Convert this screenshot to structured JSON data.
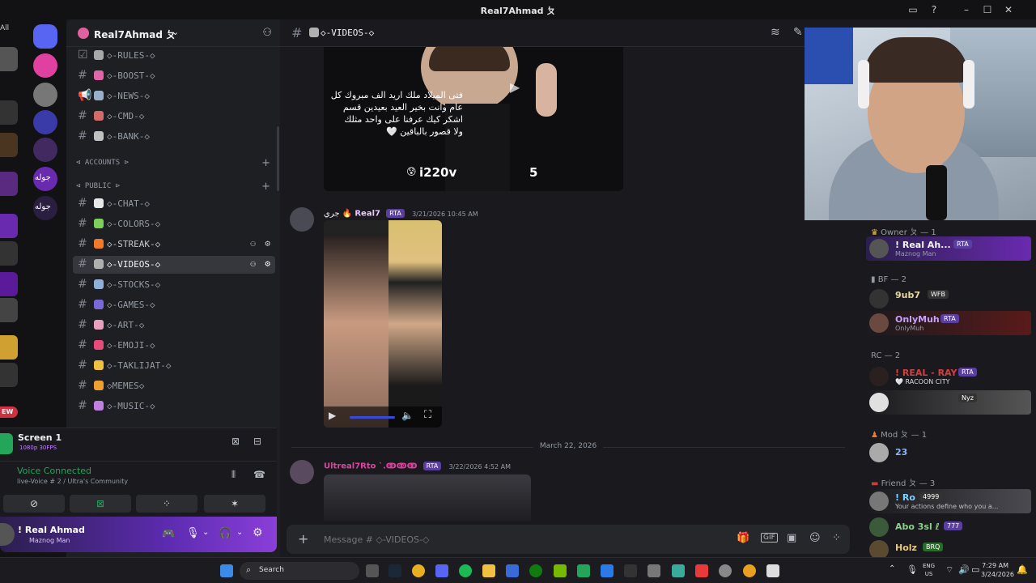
{
  "window": {
    "title": "Real7Ahmad ㄆ",
    "left_fragment": "All"
  },
  "server": {
    "name": "Real7Ahmad ㄆ"
  },
  "channels_top": [
    {
      "name": "◇-RULES-◇",
      "icon": "rules-icon",
      "color": "#a8a8a8"
    },
    {
      "name": "◇-BOOST-◇",
      "icon": "boost-icon",
      "color": "#e066a8"
    },
    {
      "name": "◇-NEWS-◇",
      "icon": "news-icon",
      "color": "#9ab0c8"
    },
    {
      "name": "◇-CMD-◇",
      "icon": "cmd-icon",
      "color": "#d46a6a"
    },
    {
      "name": "◇-BANK-◇",
      "icon": "bank-icon",
      "color": "#c0c0c0"
    }
  ],
  "categories": {
    "accounts": "ACCOUNTS ⊳",
    "public": "PUBLIC ⊳"
  },
  "channels_public": [
    {
      "name": "◇-CHAT-◇",
      "icon": "chat-icon",
      "color": "#e8e8e8"
    },
    {
      "name": "◇-COLORS-◇",
      "icon": "colors-icon",
      "color": "#7ccf5a"
    },
    {
      "name": "◇-STREAK-◇",
      "icon": "streak-icon",
      "color": "#f07a2a"
    },
    {
      "name": "◇-VIDEOS-◇",
      "icon": "videos-icon",
      "color": "#b0b0b0"
    },
    {
      "name": "◇-STOCKS-◇",
      "icon": "stocks-icon",
      "color": "#8fb0d8"
    },
    {
      "name": "◇-GAMES-◇",
      "icon": "games-icon",
      "color": "#7a6ad8"
    },
    {
      "name": "◇-ART-◇",
      "icon": "art-icon",
      "color": "#e8a0c0"
    },
    {
      "name": "◇-EMOJI-◇",
      "icon": "emoji-icon",
      "color": "#e84a7a"
    },
    {
      "name": "◇-TAKLIJAT-◇",
      "icon": "taklijat-icon",
      "color": "#f0c040"
    },
    {
      "name": "◇MEMES◇",
      "icon": "memes-icon",
      "color": "#f0a030"
    },
    {
      "name": "◇-MUSIC-◇",
      "icon": "music-icon",
      "color": "#c080e0"
    }
  ],
  "stream": {
    "title": "Screen 1",
    "quality": "1080p 30FPS"
  },
  "voice": {
    "status": "Voice Connected",
    "channel": "live-Voice # 2",
    "community": "/ Ultra's Community"
  },
  "user": {
    "name": "! Real Ahmad",
    "status": "Maznog Man"
  },
  "chat": {
    "channel": "◇-VIDEOS-◇",
    "video1": {
      "arabic_lines": [
        "فتى الميلاد ملك اريد الف مبروك كل",
        "عام وانت بخير العيد بعيدين قسم",
        "اشكر كيك عرفنا على واحد مثلك",
        "ولا قصور بالباقين 🤍"
      ],
      "overlay_name": "i220v",
      "overlay_number": "5"
    },
    "message1": {
      "author_prefix": "جري",
      "author": "Real7",
      "badge": "RTA",
      "timestamp": "3/21/2026 10:45 AM"
    },
    "date_divider": "March 22, 2026",
    "message2": {
      "author": "Ultreal7Rto `.ↂↂↂ",
      "badge": "RTA",
      "timestamp": "3/22/2026 4:52 AM"
    },
    "input_placeholder": "Message # ◇-VIDEOS-◇"
  },
  "members": {
    "groups": [
      {
        "label": "Owner ㄆ — 1"
      },
      {
        "label": "BF — 2"
      },
      {
        "label": "RC — 2"
      },
      {
        "label": "Mod ㄆ — 1"
      },
      {
        "label": "Friend ㄆ — 3"
      }
    ],
    "entries": [
      {
        "name": "! Real Ah...",
        "badge": "RTA",
        "sub": "Maznog Man",
        "color": "#f2f3f5"
      },
      {
        "name": "9ub7",
        "badge": "WFB",
        "sub": "",
        "color": "#e8d8a0"
      },
      {
        "name": "OnlyMuh",
        "badge": "RTA",
        "sub": "OnlyMuh",
        "color": "#c8a0ff"
      },
      {
        "name": "! REAL - RAY",
        "badge": "RTA",
        "sub": "🤍 RACOON CITY",
        "color": "#d04040"
      },
      {
        "name": "",
        "badge": "Nyz",
        "sub": "",
        "color": "#d04040"
      },
      {
        "name": "23",
        "badge": "",
        "sub": "",
        "color": "#8ab4ff"
      },
      {
        "name": "! Ro",
        "badge": "4999",
        "sub": "Your actions define who you a...",
        "color": "#7ad0ff"
      },
      {
        "name": "Abo 3sl ℓ",
        "badge": "777",
        "sub": "",
        "color": "#8ad08a"
      },
      {
        "name": "Holz",
        "badge": "BRQ",
        "sub": "",
        "color": "#e8c878"
      }
    ]
  },
  "taskbar": {
    "search": "Search",
    "lang1": "ENG",
    "lang2": "US",
    "time": "7:29 AM",
    "date": "3/24/2026"
  },
  "left_badges": [
    "EW"
  ],
  "left_arabic": [
    "جوله",
    "جوله"
  ]
}
